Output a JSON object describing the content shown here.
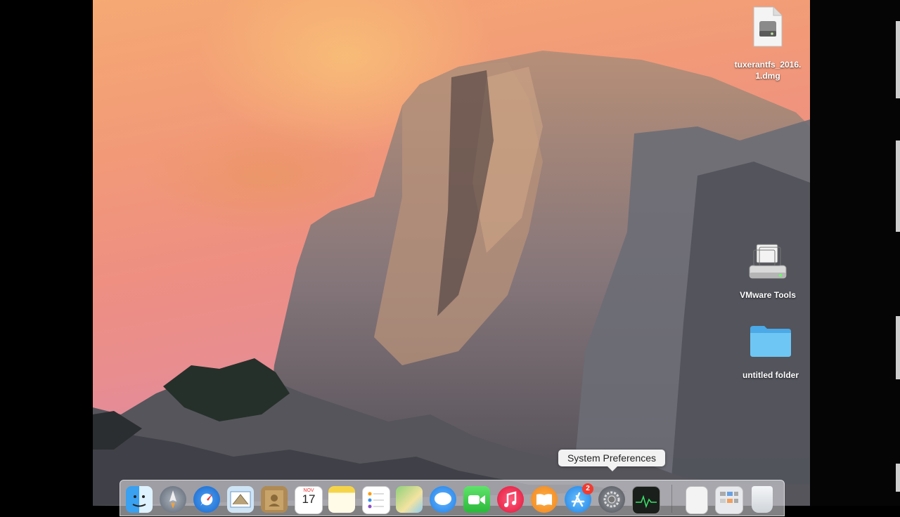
{
  "desktop": {
    "icons": [
      {
        "id": "dmg",
        "label": "tuxerantfs_2016.\n1.dmg"
      },
      {
        "id": "vmware",
        "label": "VMware Tools"
      },
      {
        "id": "folder",
        "label": "untitled folder"
      }
    ]
  },
  "tooltip": {
    "text": "System Preferences"
  },
  "dock": {
    "calendar": {
      "month": "NOV",
      "day": "17"
    },
    "app_store_badge": "2",
    "items": [
      "finder-icon",
      "launchpad-icon",
      "safari-icon",
      "mail-icon",
      "contacts-icon",
      "calendar-icon",
      "notes-icon",
      "reminders-icon",
      "maps-icon",
      "messages-icon",
      "facetime-icon",
      "itunes-icon",
      "ibooks-icon",
      "app-store-icon",
      "system-preferences-icon",
      "activity-monitor-icon",
      "document-icon",
      "downloads-stack-icon",
      "trash-icon"
    ]
  },
  "colors": {
    "sky_top": "#f5a973",
    "sky_bottom": "#c07fb6",
    "rock": "#6f6a6f",
    "folder": "#5bbcf0",
    "badge": "#f23b30"
  }
}
